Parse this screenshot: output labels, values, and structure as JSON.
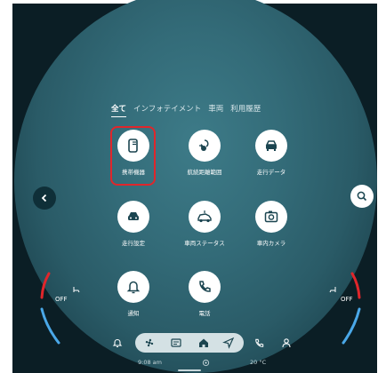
{
  "tabs": [
    {
      "label": "全て",
      "active": true
    },
    {
      "label": "インフォテイメント"
    },
    {
      "label": "車両"
    },
    {
      "label": "利用履歴"
    }
  ],
  "apps": [
    {
      "id": "portable-device",
      "label": "携帯機器",
      "icon": "phone-icon",
      "highlighted": true
    },
    {
      "id": "cruising-range",
      "label": "航続距離範囲",
      "icon": "ev-range-icon"
    },
    {
      "id": "driving-data",
      "label": "走行データ",
      "icon": "car-front-icon"
    },
    {
      "id": "driving-settings",
      "label": "走行設定",
      "icon": "car-settings-icon"
    },
    {
      "id": "vehicle-status",
      "label": "車両ステータス",
      "icon": "car-status-icon"
    },
    {
      "id": "in-car-camera",
      "label": "車内カメラ",
      "icon": "camera-icon"
    },
    {
      "id": "notifications",
      "label": "通知",
      "icon": "bell-icon"
    },
    {
      "id": "phone",
      "label": "電話",
      "icon": "handset-icon"
    }
  ],
  "climate": {
    "left_label": "OFF",
    "right_label": "OFF"
  },
  "status": {
    "time": "9:08 am",
    "temperature": "20 °C"
  },
  "colors": {
    "highlight": "#e0262b",
    "climate_hot": "#e0262b",
    "climate_cold": "#4aa8e8"
  }
}
